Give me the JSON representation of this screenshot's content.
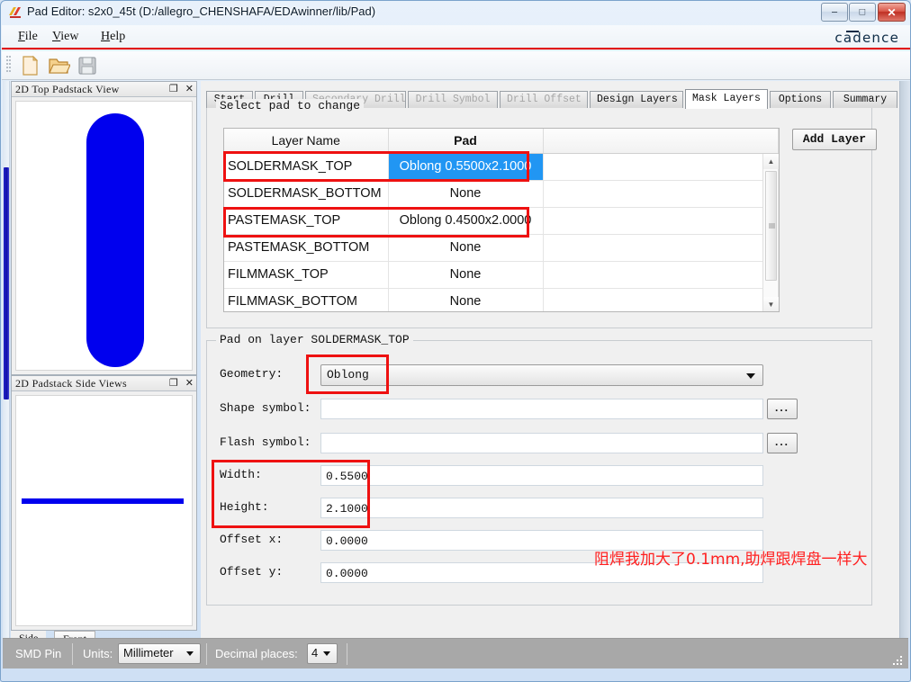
{
  "window": {
    "title": "Pad Editor: s2x0_45t  (D:/allegro_CHENSHAFA/EDAwinner/lib/Pad)",
    "minimize_label": "–",
    "maximize_label": "□",
    "close_label": "✕"
  },
  "menu": {
    "items": [
      {
        "label": "File",
        "mnemonic": "F",
        "rest": "ile"
      },
      {
        "label": "View",
        "mnemonic": "V",
        "rest": "iew"
      },
      {
        "label": "Help",
        "mnemonic": "H",
        "rest": "elp"
      }
    ],
    "brand": "cadence"
  },
  "toolbar": {
    "buttons": [
      {
        "name": "new-file-icon",
        "tooltip": "New"
      },
      {
        "name": "open-folder-icon",
        "tooltip": "Open"
      },
      {
        "name": "save-icon",
        "tooltip": "Save"
      }
    ]
  },
  "docks": {
    "top_view": {
      "title": "2D Top Padstack View",
      "float_label": "❐",
      "close_label": "✕"
    },
    "side_views": {
      "title": "2D Padstack Side Views",
      "float_label": "❐",
      "close_label": "✕"
    },
    "view_tabs": [
      {
        "label": "Side",
        "active": true
      },
      {
        "label": "Front",
        "active": false
      }
    ]
  },
  "tabs": [
    {
      "label": "Start",
      "state": "normal"
    },
    {
      "label": "Drill",
      "state": "normal"
    },
    {
      "label": "Secondary Drill",
      "state": "disabled"
    },
    {
      "label": "Drill Symbol",
      "state": "disabled"
    },
    {
      "label": "Drill Offset",
      "state": "disabled"
    },
    {
      "label": "Design Layers",
      "state": "normal"
    },
    {
      "label": "Mask Layers",
      "state": "active"
    },
    {
      "label": "Options",
      "state": "normal"
    },
    {
      "label": "Summary",
      "state": "normal"
    }
  ],
  "select_group": {
    "legend": "Select pad to change",
    "columns": [
      "Layer Name",
      "Pad",
      ""
    ],
    "rows": [
      {
        "layer": "SOLDERMASK_TOP",
        "pad": "Oblong 0.5500x2.1000",
        "selected": true,
        "highlighted": true
      },
      {
        "layer": "SOLDERMASK_BOTTOM",
        "pad": "None",
        "selected": false,
        "highlighted": false
      },
      {
        "layer": "PASTEMASK_TOP",
        "pad": "Oblong 0.4500x2.0000",
        "selected": false,
        "highlighted": true
      },
      {
        "layer": "PASTEMASK_BOTTOM",
        "pad": "None",
        "selected": false,
        "highlighted": false
      },
      {
        "layer": "FILMMASK_TOP",
        "pad": "None",
        "selected": false,
        "highlighted": false
      },
      {
        "layer": "FILMMASK_BOTTOM",
        "pad": "None",
        "selected": false,
        "highlighted": false
      }
    ],
    "add_layer_label": "Add Layer",
    "scroll_up_label": "▲",
    "scroll_down_label": "▼"
  },
  "pad_group": {
    "legend": "Pad on layer SOLDERMASK_TOP",
    "fields": {
      "geometry_label": "Geometry:",
      "geometry_value": "Oblong",
      "shape_symbol_label": "Shape symbol:",
      "shape_symbol_value": "",
      "flash_symbol_label": "Flash symbol:",
      "flash_symbol_value": "",
      "width_label": "Width:",
      "width_value": "0.5500",
      "height_label": "Height:",
      "height_value": "2.1000",
      "offset_x_label": "Offset x:",
      "offset_x_value": "0.0000",
      "offset_y_label": "Offset y:",
      "offset_y_value": "0.0000"
    },
    "browse_label": "...",
    "annotation": "阻焊我加大了0.1mm,助焊跟焊盘一样大"
  },
  "statusbar": {
    "pin_type": "SMD Pin",
    "units_label": "Units:",
    "units_value": "Millimeter",
    "decimal_label": "Decimal places:",
    "decimal_value": "4"
  },
  "colors": {
    "pad_blue": "#0000ee",
    "highlight_red": "#ee1111",
    "selection_blue": "#2196f3",
    "accent_red": "#e00000",
    "annotation_red": "#ff2020"
  }
}
